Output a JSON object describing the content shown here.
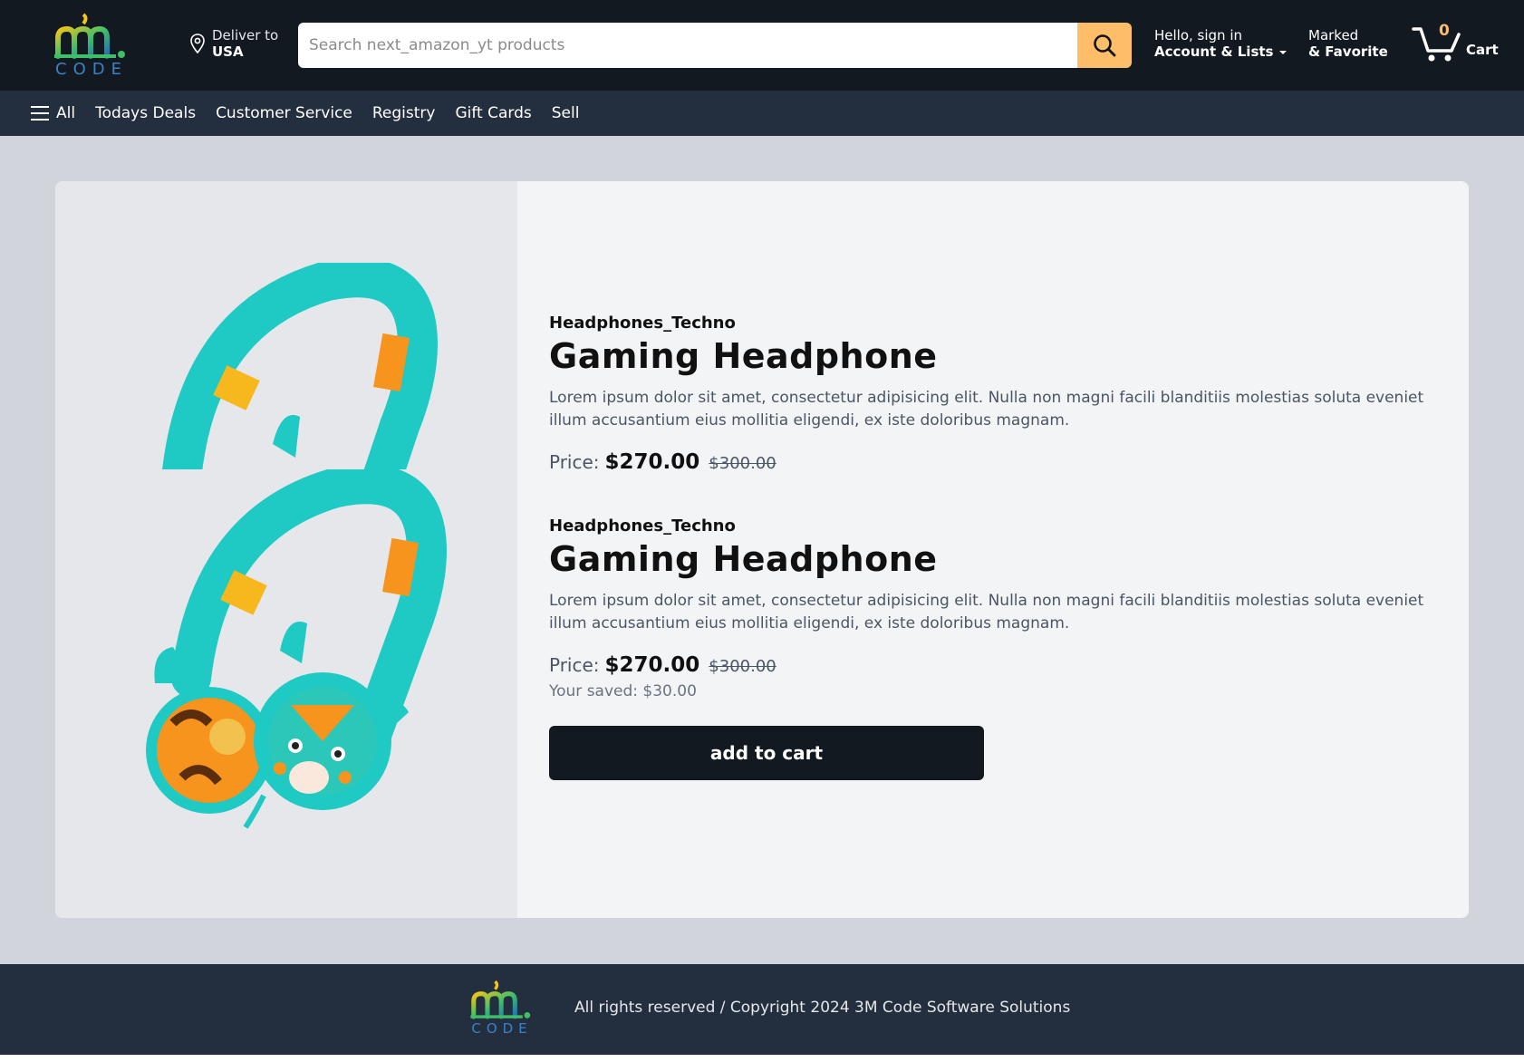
{
  "header": {
    "logo_text": "CODE",
    "deliver_label": "Deliver to",
    "deliver_country": "USA",
    "search_placeholder": "Search next_amazon_yt products",
    "account_greeting": "Hello, sign in",
    "account_lists": "Account & Lists",
    "marked_l1": "Marked",
    "marked_l2": "& Favorite",
    "cart_count": "0",
    "cart_label": "Cart"
  },
  "nav": {
    "items": [
      "All",
      "Todays Deals",
      "Customer Service",
      "Registry",
      "Gift Cards",
      "Sell"
    ]
  },
  "products": [
    {
      "brand": "Headphones_Techno",
      "title": "Gaming Headphone",
      "description": "Lorem ipsum dolor sit amet, consectetur adipisicing elit. Nulla non magni facili blanditiis molestias soluta eveniet illum accusantium eius mollitia eligendi, ex iste doloribus magnam.",
      "price_label": "Price:",
      "price": "$270.00",
      "old_price": "$300.00"
    },
    {
      "brand": "Headphones_Techno",
      "title": "Gaming Headphone",
      "description": "Lorem ipsum dolor sit amet, consectetur adipisicing elit. Nulla non magni facili blanditiis molestias soluta eveniet illum accusantium eius mollitia eligendi, ex iste doloribus magnam.",
      "price_label": "Price:",
      "price": "$270.00",
      "old_price": "$300.00",
      "saved": "Your saved: $30.00",
      "add_to_cart": "add to cart"
    }
  ],
  "footer": {
    "logo_text": "CODE",
    "copyright": "All rights reserved / Copyright 2024 3M Code Software Solutions"
  },
  "colors": {
    "header_bg": "#131921",
    "nav_bg": "#232f3e",
    "accent": "#febd69",
    "headphone_teal": "#1fc9c4",
    "headphone_orange": "#f7941d"
  },
  "icons": [
    "location-pin-icon",
    "search-icon",
    "caret-down-icon",
    "cart-icon",
    "menu-icon"
  ]
}
